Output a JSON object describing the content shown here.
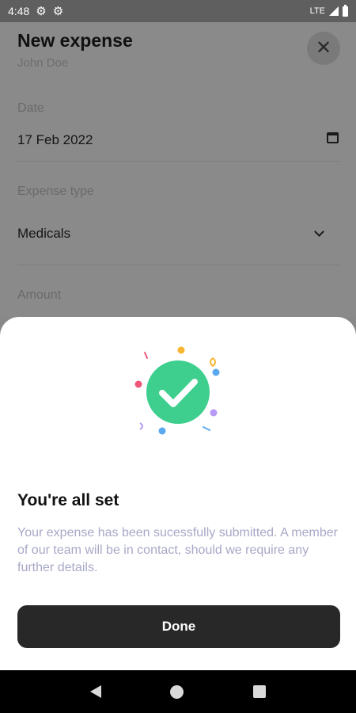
{
  "status_bar": {
    "time": "4:48",
    "network": "LTE",
    "icons": [
      "settings-icon",
      "settings-icon",
      "signal-icon",
      "battery-icon"
    ]
  },
  "form": {
    "title": "New expense",
    "subtitle": "John Doe",
    "close_icon": "close-icon",
    "fields": {
      "date": {
        "label": "Date",
        "value": "17 Feb 2022",
        "icon": "calendar-icon"
      },
      "expense_type": {
        "label": "Expense type",
        "value": "Medicals",
        "icon": "chevron-down-icon"
      },
      "amount": {
        "label": "Amount"
      }
    }
  },
  "sheet": {
    "illustration": "success-check-icon",
    "title": "You're all set",
    "message": "Your expense has been sucessfully submitted. A member of our team will be in contact, should we require any further details.",
    "done_label": "Done"
  },
  "nav_bar": {
    "items": [
      "back-icon",
      "home-icon",
      "recent-apps-icon"
    ]
  },
  "colors": {
    "success_green": "#3ecf8e",
    "button_dark": "#282828",
    "message_text": "#a7a8c7"
  }
}
